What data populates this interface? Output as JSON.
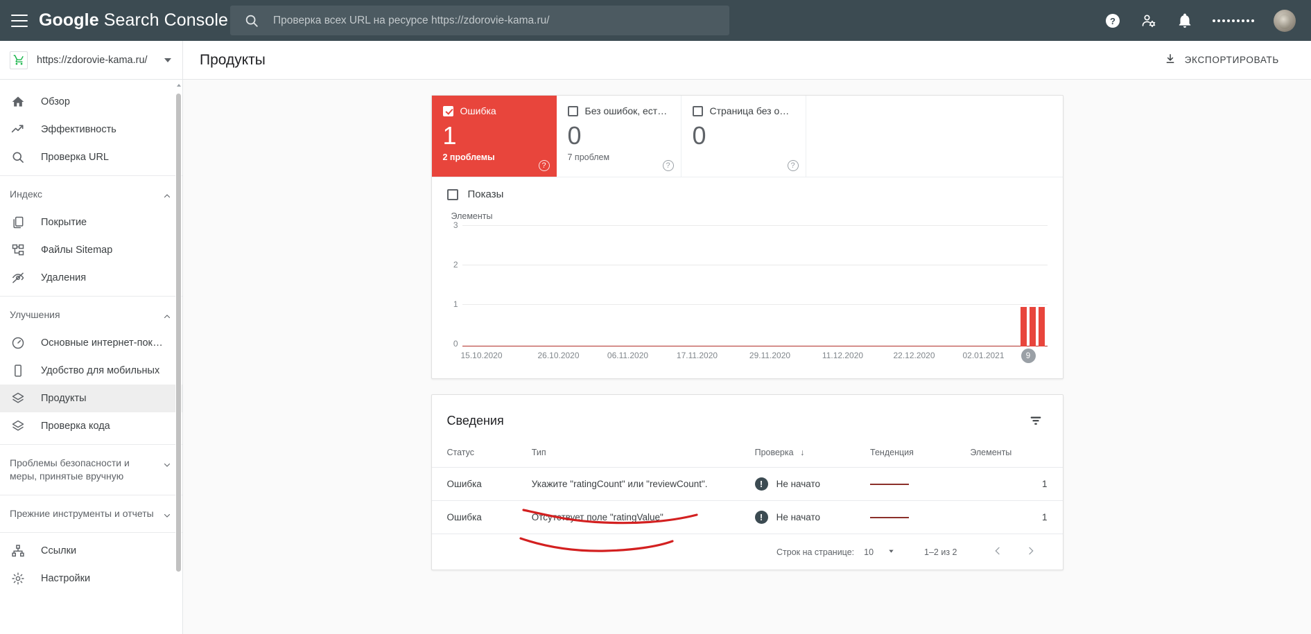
{
  "topbar": {
    "menu_icon": "hamburger-icon",
    "brand_bold": "Google",
    "brand_rest": " Search Console",
    "search": {
      "icon": "search-icon",
      "placeholder": "Проверка всех URL на ресурсе https://zdorovie-kama.ru/",
      "value": ""
    },
    "icons": [
      "help-icon",
      "user-settings-icon",
      "notifications-bell-icon",
      "apps-grid-icon",
      "avatar"
    ]
  },
  "sidebar": {
    "property": {
      "favicon": "shopping-cart-icon",
      "url": "https://zdorovie-kama.ru/",
      "chevron": "chevron-down-icon"
    },
    "group1": [
      {
        "icon": "home-icon",
        "label": "Обзор"
      },
      {
        "icon": "trending-up-icon",
        "label": "Эффективность"
      },
      {
        "icon": "search-icon",
        "label": "Проверка URL"
      }
    ],
    "section_index": {
      "label": "Индекс",
      "chevron": "chevron-up-icon"
    },
    "group_index": [
      {
        "icon": "pages-icon",
        "label": "Покрытие"
      },
      {
        "icon": "sitemap-icon",
        "label": "Файлы Sitemap"
      },
      {
        "icon": "eye-off-icon",
        "label": "Удаления"
      }
    ],
    "section_enh": {
      "label": "Улучшения",
      "chevron": "chevron-up-icon"
    },
    "group_enh": [
      {
        "icon": "speedometer-icon",
        "label": "Основные интернет-показ…",
        "active": false
      },
      {
        "icon": "mobile-icon",
        "label": "Удобство для мобильных",
        "active": false
      },
      {
        "icon": "layers-icon",
        "label": "Продукты",
        "active": true
      },
      {
        "icon": "layers-icon",
        "label": "Проверка кода",
        "active": false
      }
    ],
    "section_security": {
      "label": "Проблемы безопасности и меры, принятые вручную",
      "chevron": "chevron-down-icon"
    },
    "section_legacy": {
      "label": "Прежние инструменты и отчеты",
      "chevron": "chevron-down-icon"
    },
    "group_bottom": [
      {
        "icon": "links-icon",
        "label": "Ссылки"
      },
      {
        "icon": "gear-icon",
        "label": "Настройки"
      }
    ]
  },
  "page": {
    "title": "Продукты",
    "export": {
      "icon": "download-icon",
      "label": "ЭКСПОРТИРОВАТЬ"
    }
  },
  "status_cards": [
    {
      "label": "Ошибка",
      "value": "1",
      "sub": "2 проблемы",
      "checked": true,
      "selected": true,
      "help": "?"
    },
    {
      "label": "Без ошибок, ест…",
      "value": "0",
      "sub": "7 проблем",
      "checked": false,
      "selected": false,
      "help": "?"
    },
    {
      "label": "Страница без о…",
      "value": "0",
      "sub": "",
      "checked": false,
      "selected": false,
      "help": "?"
    }
  ],
  "impressions_toggle": {
    "label": "Показы",
    "checked": false
  },
  "chart_data": {
    "type": "bar",
    "title": "",
    "ylabel": "Элементы",
    "xlabel": "",
    "ylim": [
      0,
      3
    ],
    "yticks": [
      "0",
      "1",
      "2",
      "3"
    ],
    "grid": true,
    "legend": "none",
    "categories": [
      "15.10.2020",
      "26.10.2020",
      "06.11.2020",
      "17.11.2020",
      "29.11.2020",
      "11.12.2020",
      "22.12.2020",
      "02.01.2021"
    ],
    "series": [
      {
        "name": "Ошибка",
        "color": "#e8453c",
        "values": [
          0,
          0,
          0,
          0,
          0,
          0,
          0,
          0
        ]
      }
    ],
    "bars": [
      {
        "date": "06.01.2021",
        "value": 1
      },
      {
        "date": "07.01.2021",
        "value": 1
      },
      {
        "date": "08.01.2021",
        "value": 1
      }
    ],
    "annotation_marker": "9"
  },
  "details": {
    "title": "Сведения",
    "filter_icon": "filter-icon",
    "columns": [
      "Статус",
      "Тип",
      "Проверка",
      "Тенденция",
      "Элементы"
    ],
    "sort_column": "Проверка",
    "sort_icon": "arrow-down-icon",
    "rows": [
      {
        "status": "Ошибка",
        "type": "Укажите \"ratingCount\" или \"reviewCount\".",
        "check_icon": "warning-icon",
        "check": "Не начато",
        "trend": "flat-sparkline",
        "items": "1"
      },
      {
        "status": "Ошибка",
        "type": "Отсутствует поле \"ratingValue\"",
        "check_icon": "warning-icon",
        "check": "Не начато",
        "trend": "flat-sparkline",
        "items": "1"
      }
    ],
    "pager": {
      "rows_label": "Строк на странице:",
      "rows_value": "10",
      "rows_chevron": "chevron-down-icon",
      "range": "1–2 из 2",
      "prev_icon": "chevron-left-icon",
      "next_icon": "chevron-right-icon"
    }
  },
  "colors": {
    "error_red": "#e8453c",
    "header_bg": "#3c4b52",
    "accent_text": "#d93025"
  }
}
